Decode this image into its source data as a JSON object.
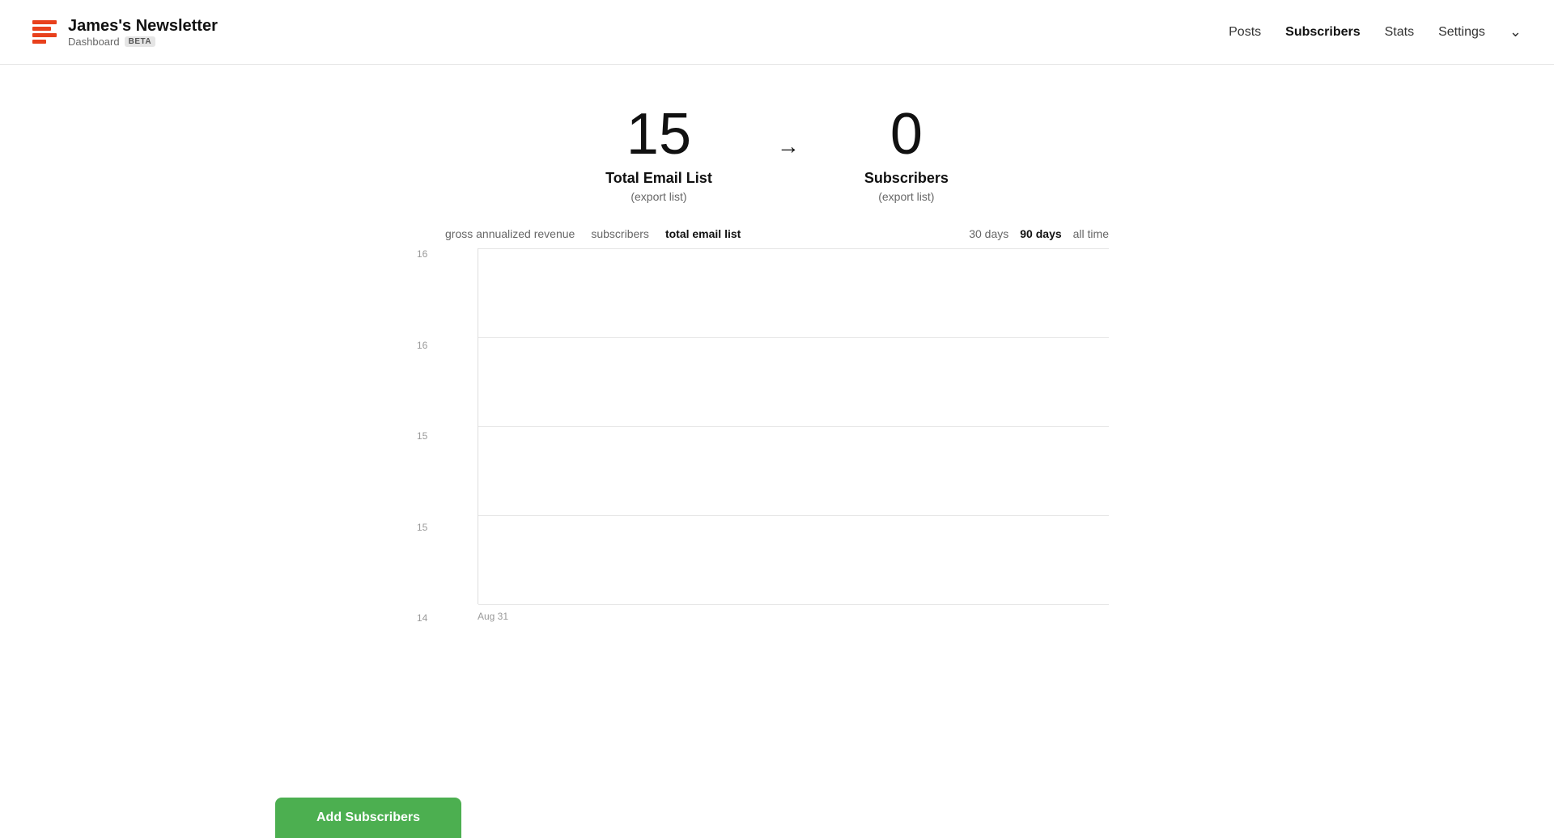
{
  "header": {
    "title": "James's Newsletter",
    "subtitle": "Dashboard",
    "beta_label": "BETA",
    "nav": [
      {
        "label": "Posts",
        "active": false
      },
      {
        "label": "Subscribers",
        "active": true
      },
      {
        "label": "Stats",
        "active": false
      },
      {
        "label": "Settings",
        "active": false
      }
    ]
  },
  "stats": {
    "total_email_list_count": "15",
    "total_email_list_label": "Total Email List",
    "total_email_list_export": "(export list)",
    "subscribers_count": "0",
    "subscribers_label": "Subscribers",
    "subscribers_export": "(export list)"
  },
  "chart": {
    "tabs": [
      {
        "label": "gross annualized revenue",
        "active": false
      },
      {
        "label": "subscribers",
        "active": false
      },
      {
        "label": "total email list",
        "active": true
      }
    ],
    "time_filters": [
      {
        "label": "30 days",
        "active": false
      },
      {
        "label": "90 days",
        "active": true
      },
      {
        "label": "all time",
        "active": false
      }
    ],
    "y_labels": [
      "16",
      "16",
      "15",
      "15",
      "14"
    ],
    "x_label": "Aug 31"
  },
  "add_subscribers_button": "Add Subscribers"
}
